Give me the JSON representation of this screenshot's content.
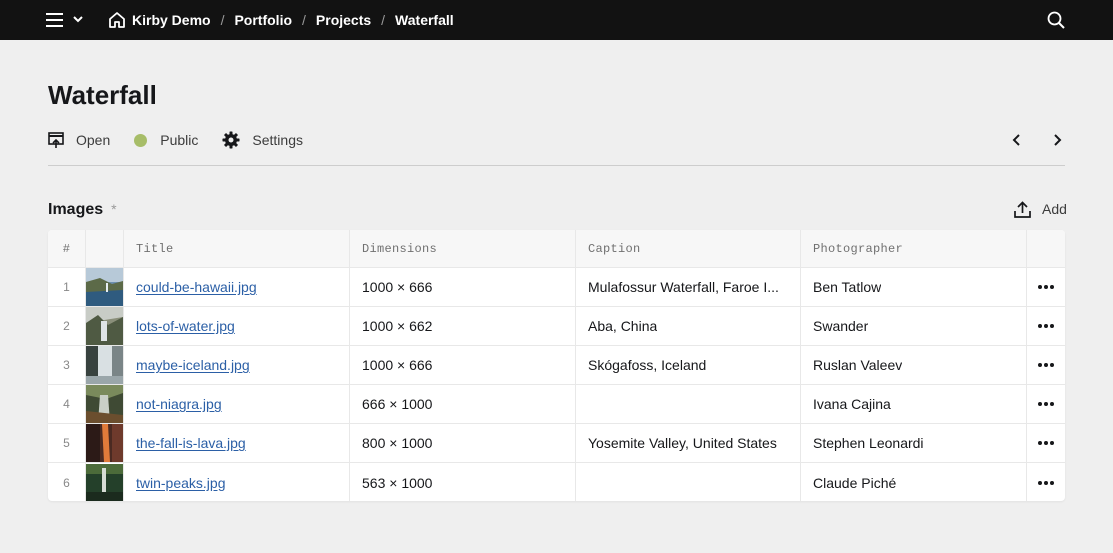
{
  "topbar": {
    "breadcrumbs": [
      "Kirby Demo",
      "Portfolio",
      "Projects",
      "Waterfall"
    ]
  },
  "page": {
    "title": "Waterfall",
    "actions": {
      "open": "Open",
      "status": "Public",
      "settings": "Settings"
    },
    "status_color": "#a7bd68"
  },
  "section": {
    "label": "Images",
    "required_marker": "*",
    "add_label": "Add"
  },
  "table": {
    "headers": {
      "index": "#",
      "title": "Title",
      "dimensions": "Dimensions",
      "caption": "Caption",
      "photographer": "Photographer"
    },
    "rows": [
      {
        "index": "1",
        "title": "could-be-hawaii.jpg",
        "dimensions": "1000 × 666",
        "caption": "Mulafossur Waterfall, Faroe I...",
        "photographer": "Ben Tatlow"
      },
      {
        "index": "2",
        "title": "lots-of-water.jpg",
        "dimensions": "1000 × 662",
        "caption": "Aba, China",
        "photographer": "Swander"
      },
      {
        "index": "3",
        "title": "maybe-iceland.jpg",
        "dimensions": "1000 × 666",
        "caption": "Skógafoss, Iceland",
        "photographer": "Ruslan Valeev"
      },
      {
        "index": "4",
        "title": "not-niagra.jpg",
        "dimensions": "666 × 1000",
        "caption": "",
        "photographer": "Ivana Cajina"
      },
      {
        "index": "5",
        "title": "the-fall-is-lava.jpg",
        "dimensions": "800 × 1000",
        "caption": "Yosemite Valley, United States",
        "photographer": "Stephen Leonardi"
      },
      {
        "index": "6",
        "title": "twin-peaks.jpg",
        "dimensions": "563 × 1000",
        "caption": "",
        "photographer": "Claude Piché"
      }
    ]
  },
  "colors": {
    "topbar": "#121212",
    "background": "#efefef",
    "link": "#2b5fa6"
  }
}
